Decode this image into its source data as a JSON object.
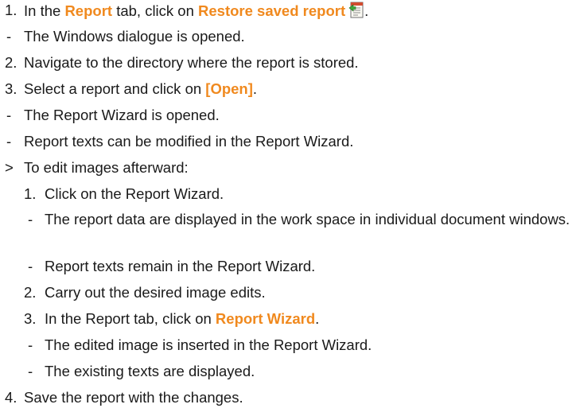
{
  "steps": {
    "s1": {
      "marker": "1.",
      "pre": "In the ",
      "tab_name": "Report",
      "mid": " tab, click on ",
      "action": "Restore saved report",
      "post": "."
    },
    "r1": {
      "marker": "-",
      "text": "The Windows dialogue is opened."
    },
    "s2": {
      "marker": "2.",
      "text": "Navigate to the directory where the report is stored."
    },
    "s3": {
      "marker": "3.",
      "pre": "Select a report and click on ",
      "button": "[Open]",
      "post": "."
    },
    "r3a": {
      "marker": "-",
      "text": "The Report Wizard is opened."
    },
    "r3b": {
      "marker": "-",
      "text": "Report texts can be modified in the Report Wizard."
    },
    "opt": {
      "marker": ">",
      "text": "To edit images afterward:"
    },
    "sub1": {
      "marker": "1.",
      "text": "Click on the Report Wizard."
    },
    "sub1r1": {
      "marker": "-",
      "text": "The report data are displayed in the work space in individual document windows."
    },
    "sub1r2": {
      "marker": "-",
      "text": "Report texts remain in the Report Wizard."
    },
    "sub2": {
      "marker": "2.",
      "text": "Carry out the desired image edits."
    },
    "sub3": {
      "marker": "3.",
      "pre": "In the Report tab, click on ",
      "action": "Report Wizard",
      "post": "."
    },
    "sub3r1": {
      "marker": "-",
      "text": "The edited image is inserted in the Report Wizard."
    },
    "sub3r2": {
      "marker": "-",
      "text": "The existing texts are displayed."
    },
    "s4": {
      "marker": "4.",
      "text": "Save the report with the changes."
    }
  },
  "icons": {
    "restore": "restore-saved-report-icon"
  },
  "colors": {
    "highlight": "#f0891e",
    "text": "#1a1a1a"
  }
}
